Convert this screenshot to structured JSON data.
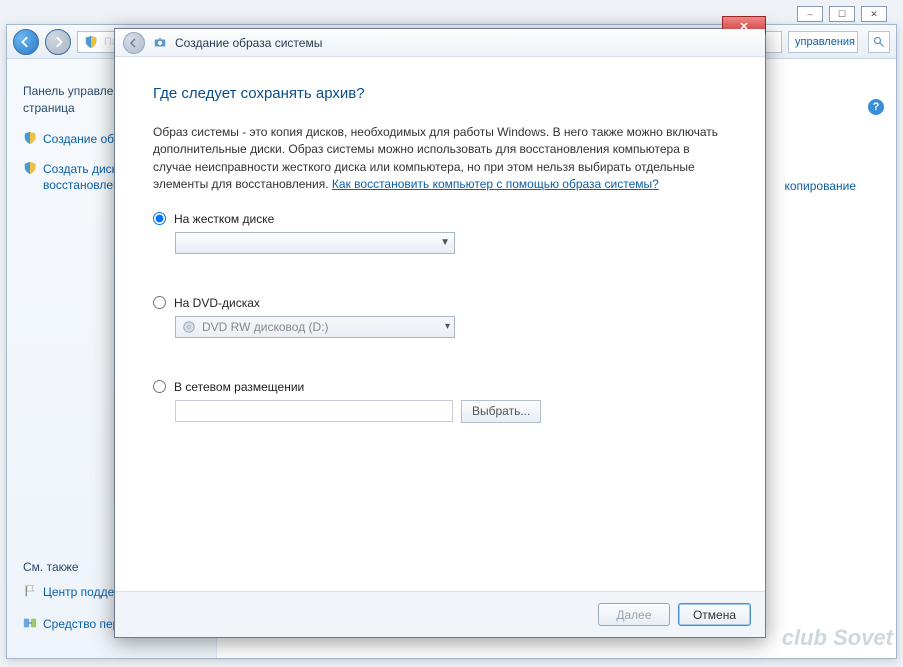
{
  "explorer": {
    "address_hint": "Панель управления ▸ ...",
    "control_label": "управления",
    "sidebar": {
      "heading": "Панель управления - домашняя страница",
      "links": [
        "Создание образа системы",
        "Создать диск восстановления системы"
      ],
      "see_also": "См. также",
      "footer_links": [
        "Центр поддержки",
        "Средство переноса Windows"
      ]
    },
    "right_link": "копирование"
  },
  "wizard": {
    "title": "Создание образа системы",
    "heading": "Где следует сохранять архив?",
    "description": "Образ системы - это копия дисков, необходимых для работы Windows. В него также можно включать дополнительные диски. Образ системы можно использовать для восстановления компьютера в случае неисправности жесткого диска или компьютера, но при этом нельзя выбирать отдельные элементы для восстановления. ",
    "desc_link": "Как восстановить компьютер с помощью образа системы?",
    "options": {
      "hdd": {
        "label": "На жестком диске",
        "value": ""
      },
      "dvd": {
        "label": "На DVD-дисках",
        "value": "DVD RW дисковод (D:)"
      },
      "net": {
        "label": "В сетевом размещении",
        "value": "",
        "browse": "Выбрать..."
      }
    },
    "buttons": {
      "next": "Далее",
      "cancel": "Отмена"
    }
  },
  "watermark": "club Sovet"
}
